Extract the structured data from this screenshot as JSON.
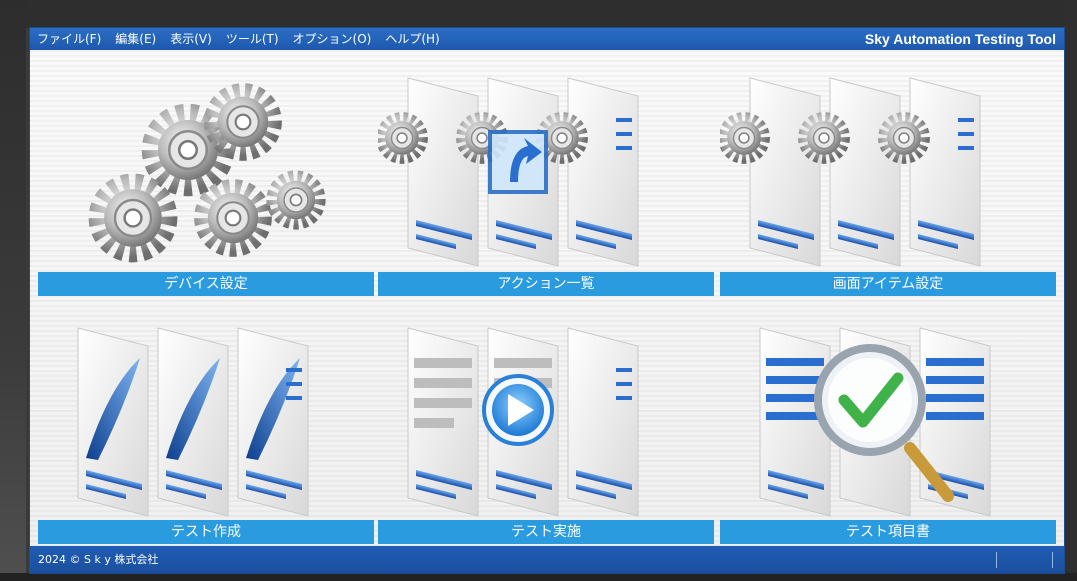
{
  "menubar": {
    "items": [
      {
        "label": "ファイル(F)"
      },
      {
        "label": "編集(E)"
      },
      {
        "label": "表示(V)"
      },
      {
        "label": "ツール(T)"
      },
      {
        "label": "オプション(O)"
      },
      {
        "label": "ヘルプ(H)"
      }
    ],
    "app_title": "Sky Automation Testing Tool"
  },
  "tiles": [
    {
      "label": "デバイス設定",
      "icon": "gears-icon"
    },
    {
      "label": "アクション一覧",
      "icon": "action-list-icon"
    },
    {
      "label": "画面アイテム設定",
      "icon": "screen-items-icon"
    },
    {
      "label": "テスト作成",
      "icon": "test-create-icon"
    },
    {
      "label": "テスト実施",
      "icon": "test-run-icon"
    },
    {
      "label": "テスト項目書",
      "icon": "test-spec-icon"
    }
  ],
  "status": {
    "copyright": "2024 © S k y 株式会社"
  },
  "colors": {
    "menubar": "#1e58ad",
    "tile_label": "#2b9be0",
    "statusbar": "#1a4f9e",
    "accent_blue": "#2a6fd0",
    "check_green": "#3fb24a"
  }
}
